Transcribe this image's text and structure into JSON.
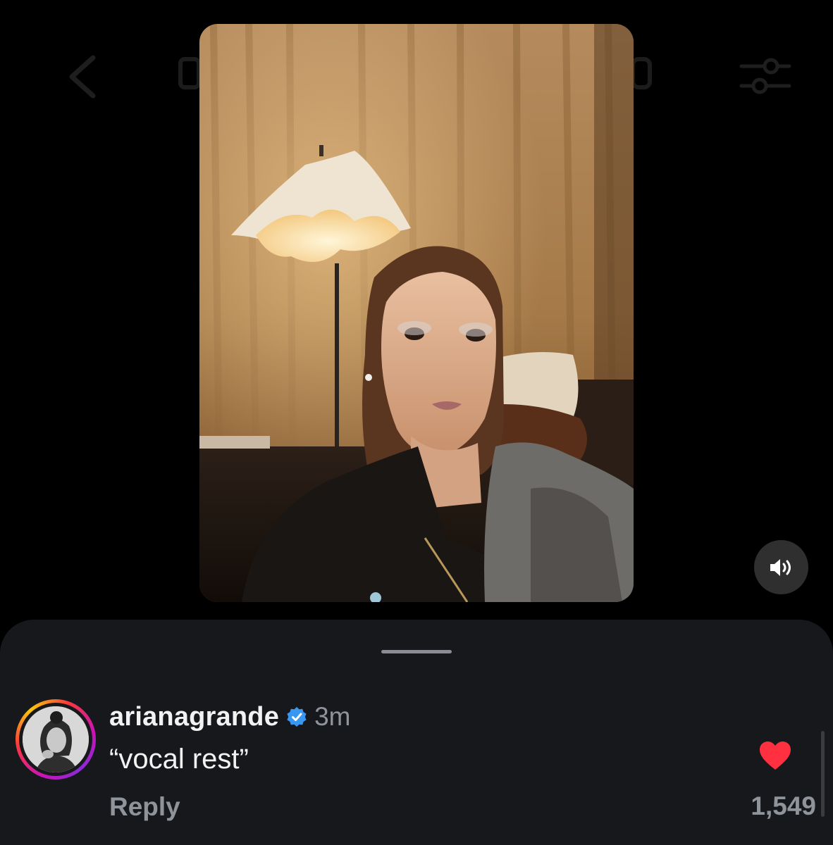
{
  "nav": {
    "back_icon": "chevron-left-icon",
    "filter_icon": "sliders-icon"
  },
  "video": {
    "sound_icon": "speaker-volume-icon"
  },
  "comment": {
    "username": "arianagrande",
    "verified_icon": "verified-badge-icon",
    "timestamp": "3m",
    "text": "“vocal rest”",
    "reply_label": "Reply",
    "like_icon": "heart-icon",
    "like_count": "1,549",
    "liked": true
  },
  "colors": {
    "background": "#000000",
    "sheet": "#16181c",
    "text_primary": "#f2f2f2",
    "text_secondary": "#8f939a",
    "heart": "#ff3040",
    "verified": "#3897f0"
  }
}
